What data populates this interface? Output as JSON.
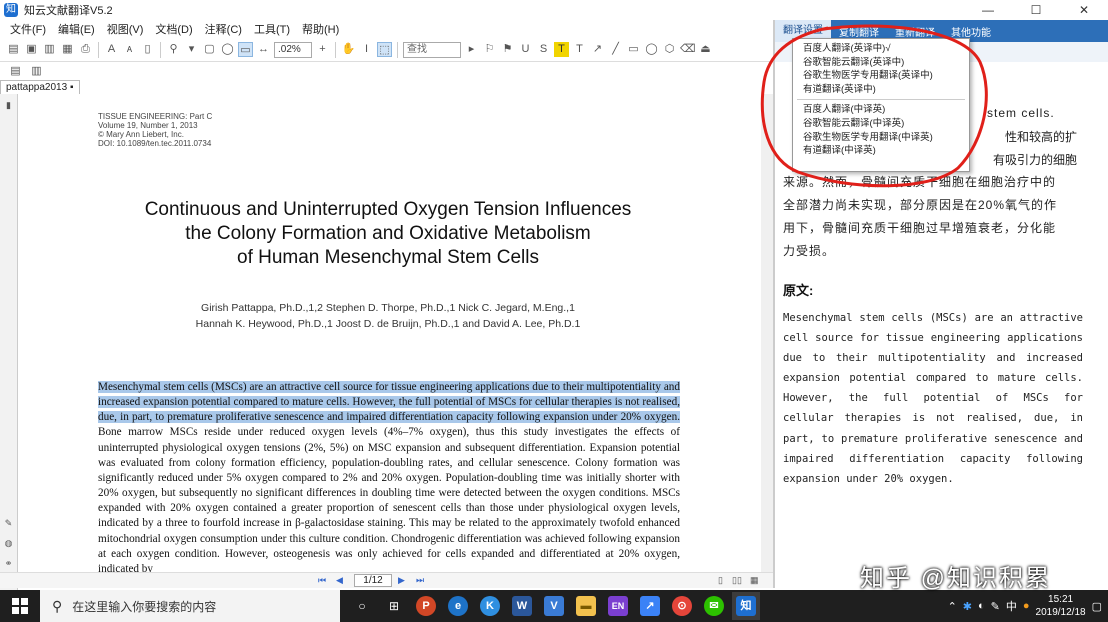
{
  "window": {
    "title": "知云文献翻译V5.2",
    "minimize": "—",
    "maximize": "☐",
    "close": "✕"
  },
  "menubar": [
    "文件(F)",
    "编辑(E)",
    "视图(V)",
    "文档(D)",
    "注释(C)",
    "工具(T)",
    "帮助(H)"
  ],
  "toolbar": {
    "zoom": ".02%",
    "search": "查找"
  },
  "doc_tab": "pattappa2013",
  "document": {
    "journal": [
      "TISSUE ENGINEERING: Part C",
      "Volume 19, Number 1, 2013",
      "© Mary Ann Liebert, Inc.",
      "DOI: 10.1089/ten.tec.2011.0734"
    ],
    "title": [
      "Continuous and Uninterrupted Oxygen Tension Influences",
      "the Colony Formation and Oxidative Metabolism",
      "of Human Mesenchymal Stem Cells"
    ],
    "authors": [
      "Girish Pattappa, Ph.D.,1,2 Stephen D. Thorpe, Ph.D.,1 Nick C. Jegard, M.Eng.,1",
      "Hannah K. Heywood, Ph.D.,1 Joost D. de Bruijn, Ph.D.,1 and David A. Lee, Ph.D.1"
    ],
    "abstract_highlighted": "Mesenchymal stem cells (MSCs) are an attractive cell source for tissue engineering applications due to their multipotentiality and increased expansion potential compared to mature cells. However, the full potential of MSCs for cellular therapies is not realised, due, in part, to premature proliferative senescence and impaired differentiation capacity following expansion under 20% oxygen.",
    "abstract_rest": " Bone marrow MSCs reside under reduced oxygen levels (4%–7% oxygen), thus this study investigates the effects of uninterrupted physiological oxygen tensions (2%, 5%) on MSC expansion and subsequent differentiation. Expansion potential was evaluated from colony formation efficiency, population-doubling rates, and cellular senescence. Colony formation was significantly reduced under 5% oxygen compared to 2% and 20% oxygen. Population-doubling time was initially shorter with 20% oxygen, but subsequently no significant differences in doubling time were detected between the oxygen conditions. MSCs expanded with 20% oxygen contained a greater proportion of senescent cells than those under physiological oxygen levels, indicated by a three to fourfold increase in β-galactosidase staining. This may be related to the approximately twofold enhanced mitochondrial oxygen consumption under this culture condition. Chondrogenic differentiation was achieved following expansion at each oxygen condition. However, osteogenesis was only achieved for cells expanded and differentiated at 20% oxygen, indicated by"
  },
  "page_nav": {
    "current": "1/12"
  },
  "right_panel": {
    "tabs": [
      "翻译设置",
      "复制翻译",
      "重新翻译",
      "其他功能"
    ],
    "menu_items_en_zh": [
      "百度人翻译(英译中)√",
      "谷歌智能云翻译(英译中)",
      "谷歌生物医学专用翻译(英译中)",
      "有道翻译(英译中)"
    ],
    "menu_items_zh_en": [
      "百度人翻译(中译英)",
      "谷歌智能云翻译(中译英)",
      "谷歌生物医学专用翻译(中译英)",
      "有道翻译(中译英)"
    ],
    "translation_partial": [
      "stem cells.",
      "性和较高的扩",
      "有吸引力的细胞"
    ],
    "translation": [
      "来源。然而，骨髓间充质干细胞在细胞治疗中的",
      "全部潜力尚未实现，部分原因是在20%氧气的作",
      "用下，骨髓间充质干细胞过早增殖衰老，分化能",
      "力受损。"
    ],
    "original_heading": "原文:",
    "original": "Mesenchymal stem cells (MSCs) are an attractive cell source for tissue engineering applications due to their multipotentiality and increased expansion potential compared to mature cells. However, the full potential of MSCs for cellular therapies is not realised, due, in part, to premature proliferative senescence and impaired differentiation capacity following expansion under 20% oxygen."
  },
  "watermark": "知乎 @知识积累",
  "taskbar": {
    "search_placeholder": "在这里输入你要搜索的内容",
    "apps": [
      "○",
      "⊞",
      "P",
      "e",
      "K",
      "W",
      "V",
      "▬",
      "EN",
      "↗",
      "⊙",
      "✉",
      "知"
    ],
    "tray_lang": "中",
    "time": "15:21",
    "date": "2019/12/18"
  }
}
